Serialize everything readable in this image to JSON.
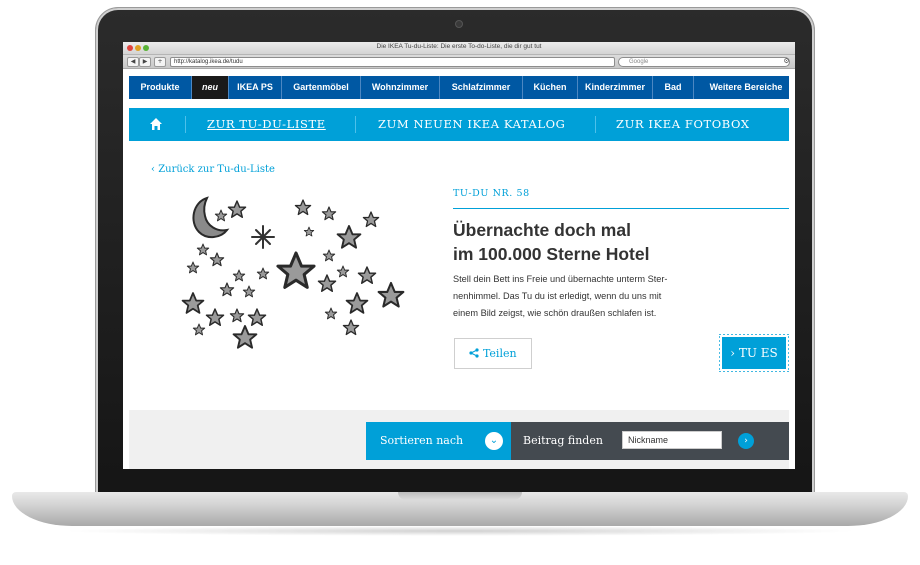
{
  "browser": {
    "window_title": "Die IKEA Tu-du-Liste: Die erste To-do-Liste, die dir gut tut",
    "back_label": "◀",
    "forward_label": "▶",
    "add_label": "+",
    "url": "http://katalog.ikea.de/tudu",
    "search_placeholder": "Google"
  },
  "topnav": {
    "items": [
      {
        "label": "Produkte"
      },
      {
        "label": "neu"
      },
      {
        "label": "IKEA PS"
      },
      {
        "label": "Gartenmöbel"
      },
      {
        "label": "Wohnzimmer"
      },
      {
        "label": "Schlafzimmer"
      },
      {
        "label": "Küchen"
      },
      {
        "label": "Kinderzimmer"
      },
      {
        "label": "Bad"
      },
      {
        "label": "Weitere Bereiche"
      }
    ]
  },
  "subnav": {
    "links": [
      {
        "label": "ZUR TU-DU-LISTE"
      },
      {
        "label": "ZUM NEUEN IKEA KATALOG"
      },
      {
        "label": "ZUR IKEA FOTOBOX"
      }
    ]
  },
  "content": {
    "back_link": "Zurück zur Tu-du-Liste",
    "number": "TU-DU NR. 58",
    "headline_line1": "Übernachte doch mal",
    "headline_line2": "im 100.000 Sterne Hotel",
    "body_line1": "Stell dein Bett ins Freie und übernachte unterm Ster-",
    "body_line2": "nenhimmel. Das Tu du ist erledigt, wenn du uns mit",
    "body_line3": "einem Bild zeigst, wie schön draußen schlafen ist.",
    "share_label": "Teilen",
    "tues_label": "TU ES"
  },
  "bottom": {
    "sort_label": "Sortieren nach",
    "find_label": "Beitrag finden",
    "nickname_value": "Nickname"
  },
  "colors": {
    "ikea_blue": "#0058a3",
    "accent_cyan": "#00a0d8",
    "dark_bar": "#444a50"
  }
}
